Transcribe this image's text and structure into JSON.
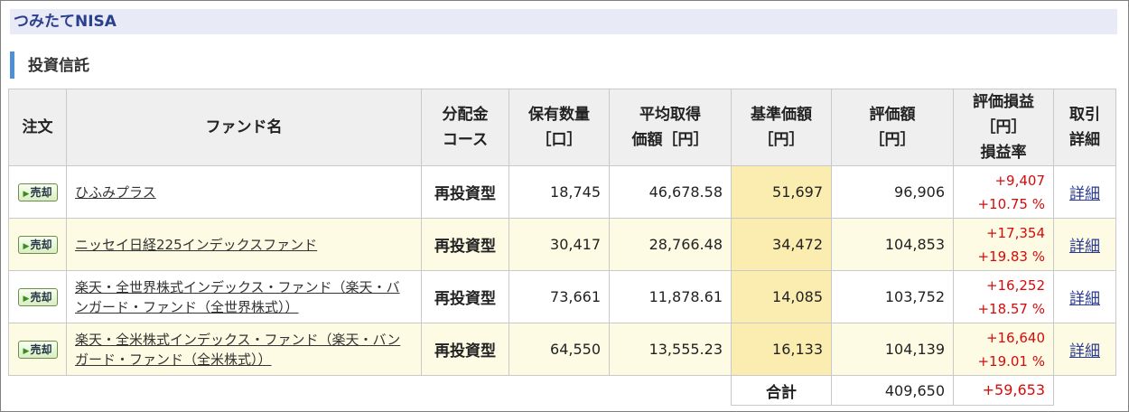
{
  "section_title": "つみたてNISA",
  "subsection_title": "投資信託",
  "columns": {
    "order": "注文",
    "fund_name": "ファンド名",
    "dividend_l1": "分配金",
    "dividend_l2": "コース",
    "holdings_l1": "保有数量",
    "holdings_l2": "［口］",
    "avg_l1": "平均取得",
    "avg_l2": "価額［円］",
    "base_l1": "基準価額",
    "base_l2": "［円］",
    "value_l1": "評価額",
    "value_l2": "［円］",
    "gain_l1": "評価損益",
    "gain_l2": "［円］",
    "gain_l3": "損益率",
    "trade_l1": "取引",
    "trade_l2": "詳細"
  },
  "sell_label": "売却",
  "rows": [
    {
      "name_line1": "ひふみプラス",
      "name_line2": "",
      "course": "再投資型",
      "holdings": "18,745",
      "avg_cost": "46,678.58",
      "base_price": "51,697",
      "value": "96,906",
      "gain": "+9,407",
      "gain_rate": "+10.75 %",
      "detail": "詳細"
    },
    {
      "name_line1": "ニッセイ日経225インデックスファンド",
      "name_line2": "",
      "course": "再投資型",
      "holdings": "30,417",
      "avg_cost": "28,766.48",
      "base_price": "34,472",
      "value": "104,853",
      "gain": "+17,354",
      "gain_rate": "+19.83 %",
      "detail": "詳細"
    },
    {
      "name_line1": "楽天・全世界株式インデックス・ファンド（楽天・バ",
      "name_line2": "ンガード・ファンド（全世界株式））",
      "course": "再投資型",
      "holdings": "73,661",
      "avg_cost": "11,878.61",
      "base_price": "14,085",
      "value": "103,752",
      "gain": "+16,252",
      "gain_rate": "+18.57 %",
      "detail": "詳細"
    },
    {
      "name_line1": "楽天・全米株式インデックス・ファンド（楽天・バン",
      "name_line2": "ガード・ファンド（全米株式））",
      "course": "再投資型",
      "holdings": "64,550",
      "avg_cost": "13,555.23",
      "base_price": "16,133",
      "value": "104,139",
      "gain": "+16,640",
      "gain_rate": "+19.01 %",
      "detail": "詳細"
    }
  ],
  "total": {
    "label": "合計",
    "value": "409,650",
    "gain": "+59,653"
  },
  "colors": {
    "header_bg": "#e8ebf6",
    "accent_bar": "#4f8fd6",
    "gain_red": "#d50b0b",
    "row_alt": "#fdfbe3",
    "price_cell": "#fbecb0"
  }
}
